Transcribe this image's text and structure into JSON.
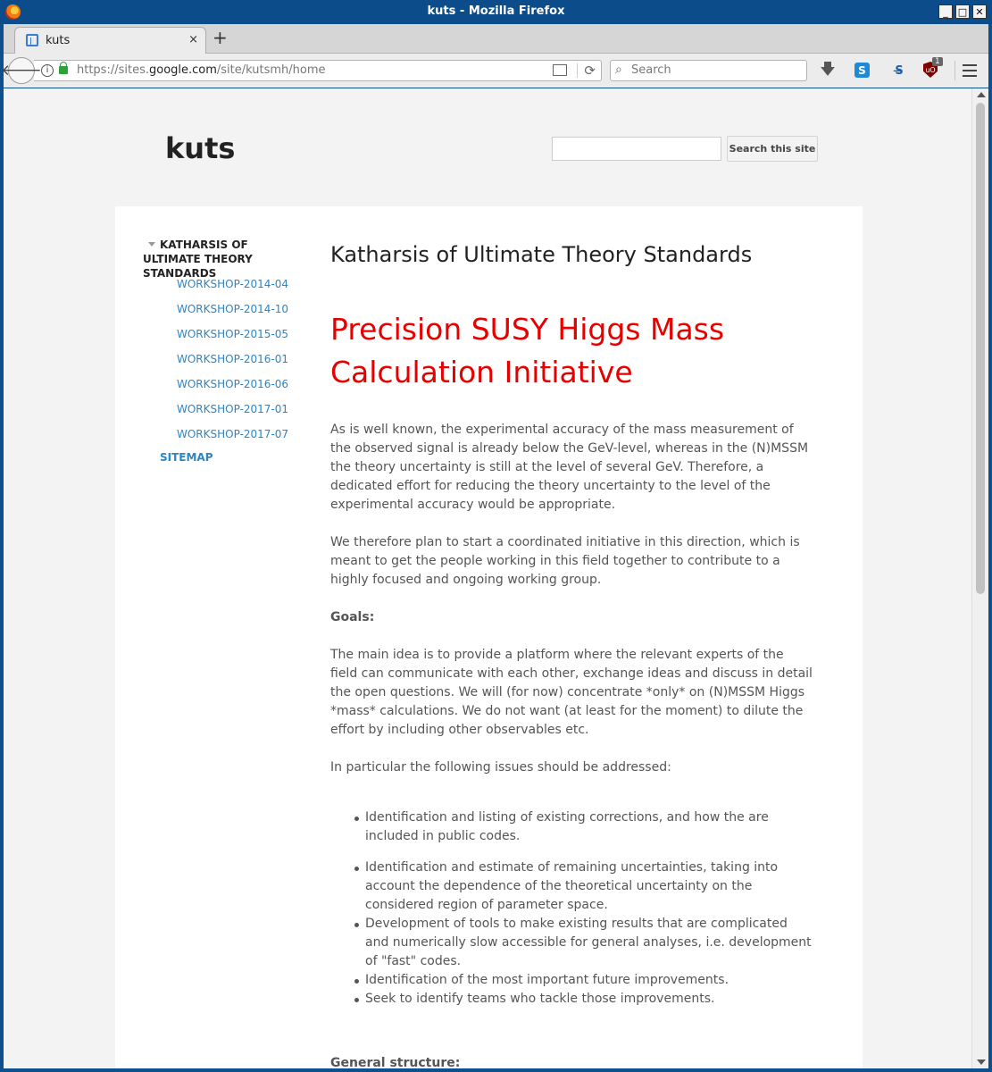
{
  "window": {
    "title": "kuts - Mozilla Firefox",
    "controls": [
      "_",
      "□",
      "✕"
    ]
  },
  "tab": {
    "label": "kuts",
    "close": "×"
  },
  "newtab": "+",
  "urlbar": {
    "url_prefix": "https://sites.",
    "url_domain": "google.com",
    "url_path": "/site/kutsmh/home"
  },
  "searchbar": {
    "placeholder": "Search"
  },
  "toolbar_icons": [
    "download-icon",
    "s-icon",
    "noscript-icon",
    "ublock-icon",
    "menu-icon"
  ],
  "ublock_badge": "1",
  "site": {
    "title": "kuts",
    "search_button": "Search this site"
  },
  "sidebar": {
    "parent": "KATHARSIS OF ULTIMATE THEORY STANDARDS",
    "items": [
      "WORKSHOP-2014-04",
      "WORKSHOP-2014-10",
      "WORKSHOP-2015-05",
      "WORKSHOP-2016-01",
      "WORKSHOP-2016-06",
      "WORKSHOP-2017-01",
      "WORKSHOP-2017-07"
    ],
    "sitemap": "SITEMAP"
  },
  "main": {
    "page_title": "Katharsis of Ultimate Theory Standards",
    "headline": "Precision SUSY Higgs Mass Calculation Initiative",
    "p1": "As is well known, the experimental accuracy of the mass measurement of the observed signal is already below the GeV-level, whereas in the  (N)MSSM the theory uncertainty is still at the level of several GeV. Therefore, a dedicated effort for reducing the theory uncertainty to the level of the experimental accuracy would be appropriate.",
    "p2": "We therefore plan to start a coordinated initiative in this direction, which is meant to get the people working in this field together to contribute to a highly focused and ongoing working group.",
    "goals_label": "Goals:",
    "p3": "The main idea is to provide a platform where the relevant experts of the field can communicate with each other, exchange ideas and discuss in detail the open questions. We will (for now) concentrate *only* on (N)MSSM Higgs *mass* calculations. We do not want (at least for the moment) to dilute the effort by including other observables etc.",
    "p4": "In particular the following issues should be addressed:",
    "bullets": [
      "Identification and listing of existing corrections, and how the are included in public codes.",
      "Identification and estimate of remaining uncertainties, taking into account the dependence of the theoretical uncertainty on the considered region of parameter space.",
      "Development of tools to make existing results that are complicated and numerically slow accessible for general analyses, i.e. development of \"fast\" codes.",
      "Identification of the most important future improvements.",
      "Seek to identify teams who tackle those improvements."
    ],
    "general_label": "General structure:"
  }
}
